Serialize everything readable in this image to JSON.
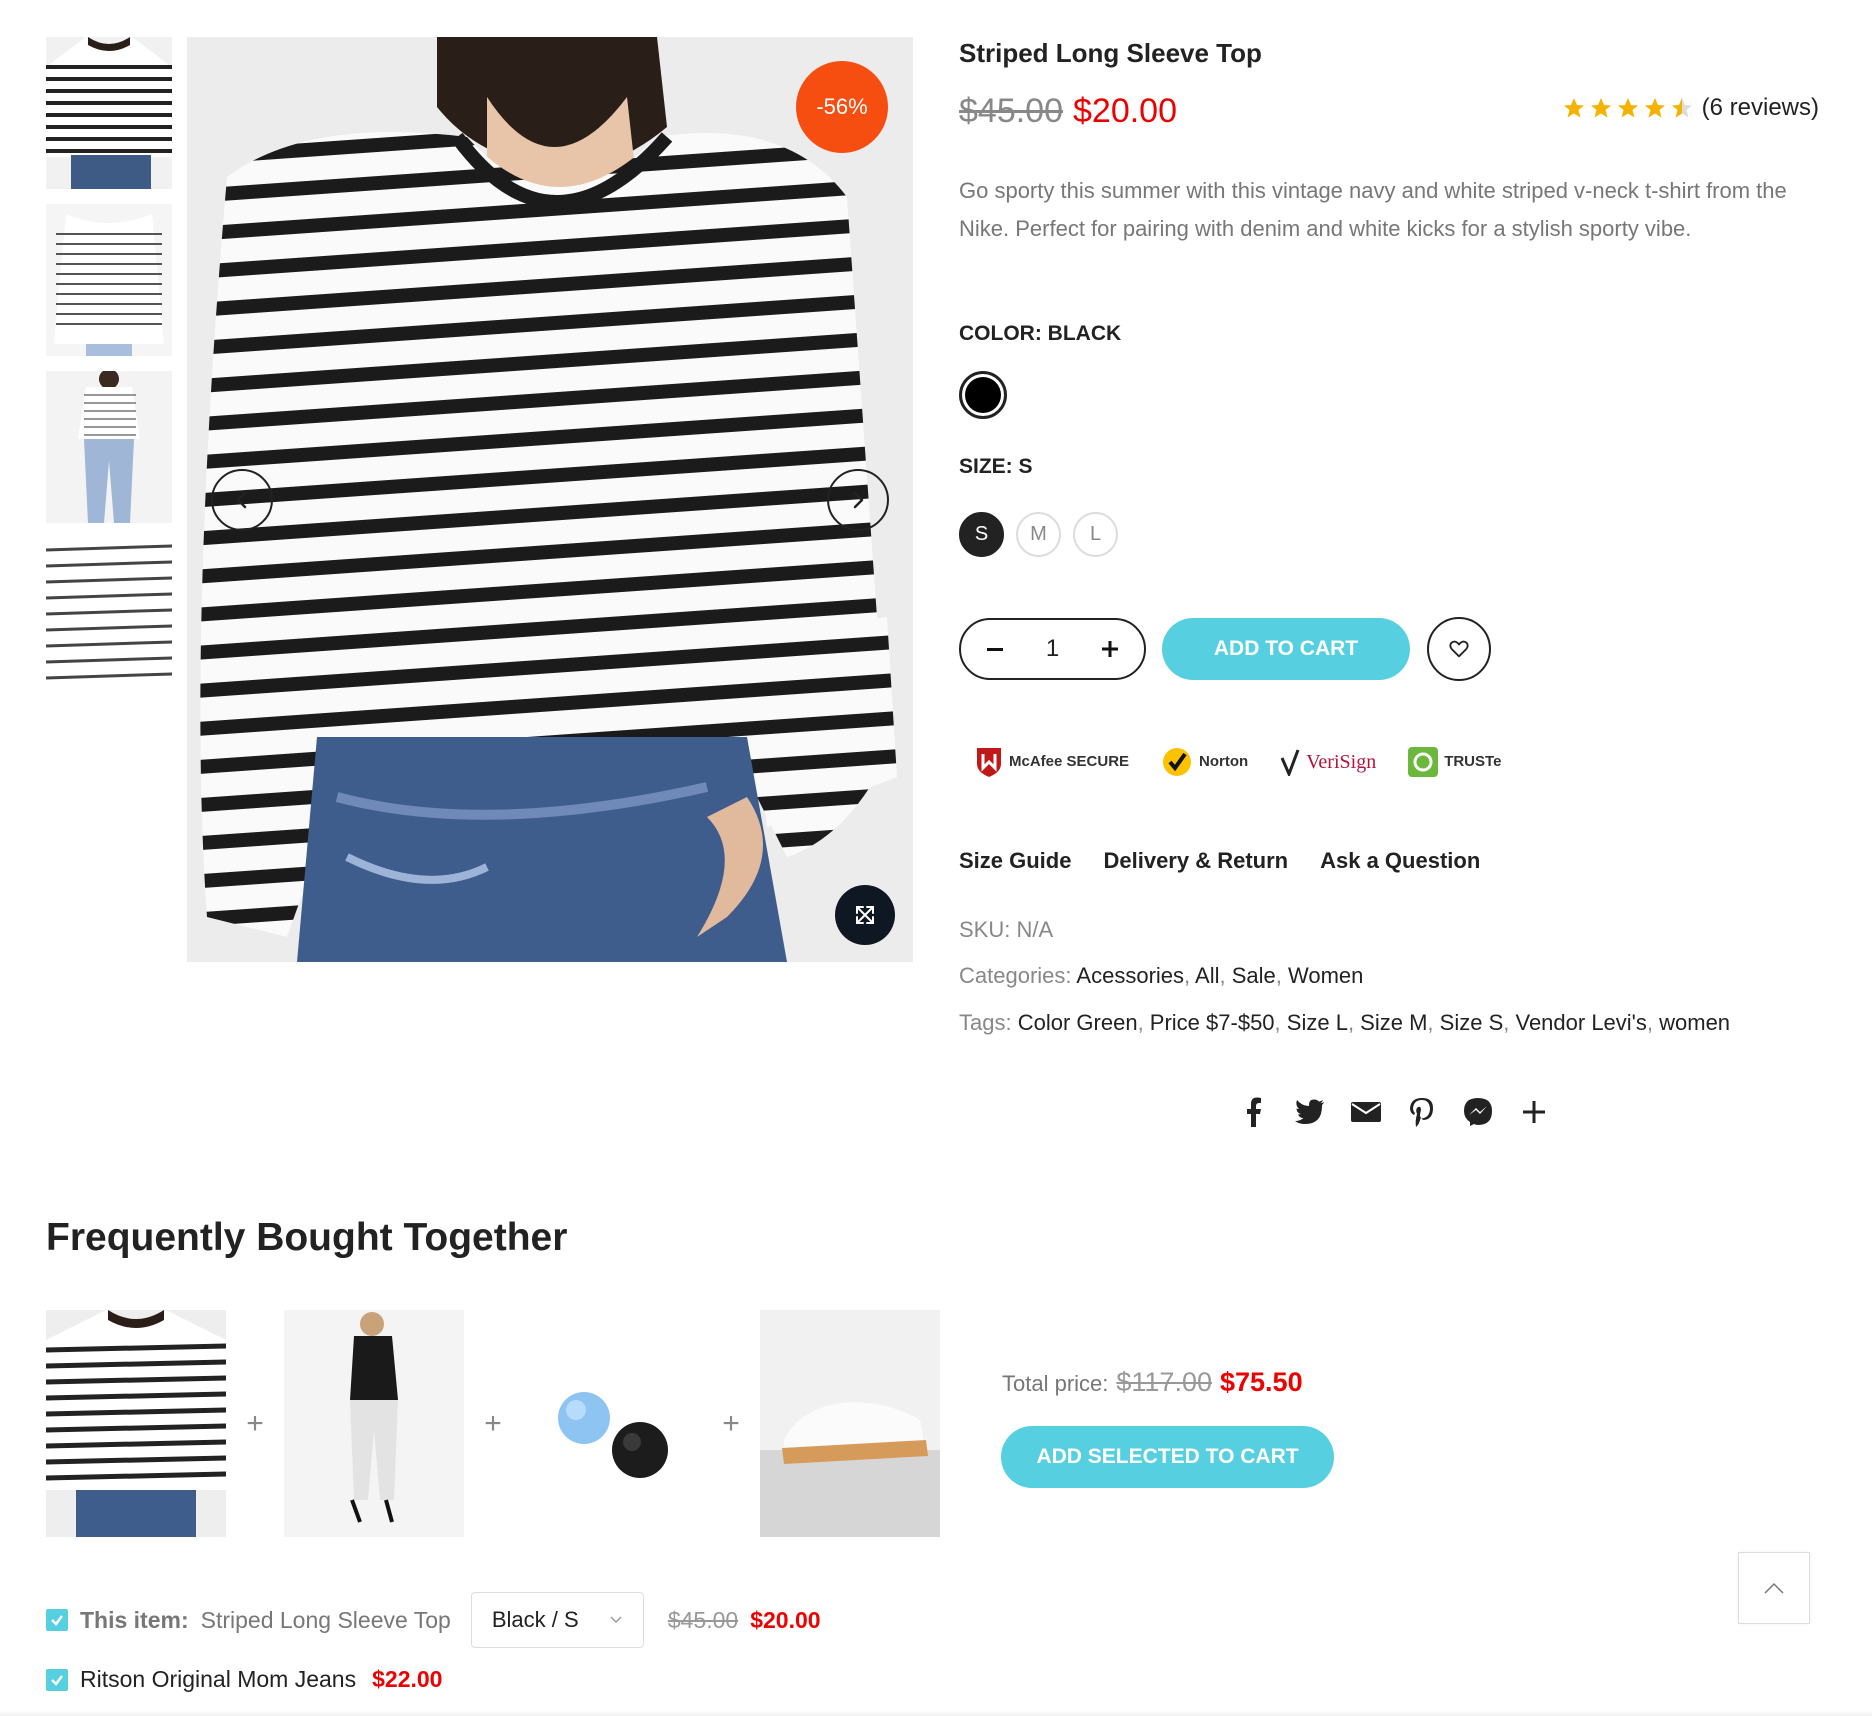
{
  "gallery": {
    "thumbnails": [
      "thumb-1",
      "thumb-2",
      "thumb-3",
      "thumb-4"
    ],
    "badge": "-56%",
    "icons": {
      "prev": "chevron-left-icon",
      "next": "chevron-right-icon",
      "zoom": "expand-icon"
    }
  },
  "product": {
    "title": "Striped Long Sleeve Top",
    "old_price": "$45.00",
    "price": "$20.00",
    "rating": 4.5,
    "reviews": "(6 reviews)",
    "description": "Go sporty this summer with this vintage navy and white striped v-neck t-shirt from the Nike. Perfect for pairing with denim and white kicks for a stylish sporty vibe.",
    "color_label": "COLOR: BLACK",
    "color_hex": "#000000",
    "size_label": "SIZE: S",
    "sizes": [
      "S",
      "M",
      "L"
    ],
    "selected_size": "S",
    "quantity": "1",
    "add_to_cart": "ADD TO CART",
    "trust_badges": [
      "McAfee SECURE",
      "Norton",
      "VeriSign",
      "TRUSTe"
    ]
  },
  "links": {
    "size_guide": "Size Guide",
    "delivery": "Delivery & Return",
    "ask": "Ask a Question"
  },
  "meta": {
    "sku_label": "SKU:",
    "sku": "N/A",
    "categories_label": "Categories:",
    "categories": [
      "Acessories",
      "All",
      "Sale",
      "Women"
    ],
    "tags_label": "Tags:",
    "tags": [
      "Color Green",
      "Price $7-$50",
      "Size L",
      "Size M",
      "Size S",
      "Vendor Levi's",
      "women"
    ]
  },
  "social": [
    "facebook-icon",
    "twitter-icon",
    "email-icon",
    "pinterest-icon",
    "messenger-icon",
    "plus-icon"
  ],
  "fbt": {
    "title": "Frequently Bought Together",
    "total_label": "Total price:",
    "total_old": "$117.00",
    "total_new": "$75.50",
    "add_selected": "ADD SELECTED TO CART",
    "items": [
      {
        "prefix": "This item:",
        "name": "Striped Long Sleeve Top",
        "variant": "Black / S",
        "old_price": "$45.00",
        "price": "$20.00"
      },
      {
        "name": "Ritson Original Mom Jeans",
        "price": "$22.00"
      }
    ]
  },
  "colors": {
    "accent": "#56cfe1",
    "sale": "#ec0101",
    "badge": "#f64d10",
    "stars": "#f5b301"
  }
}
